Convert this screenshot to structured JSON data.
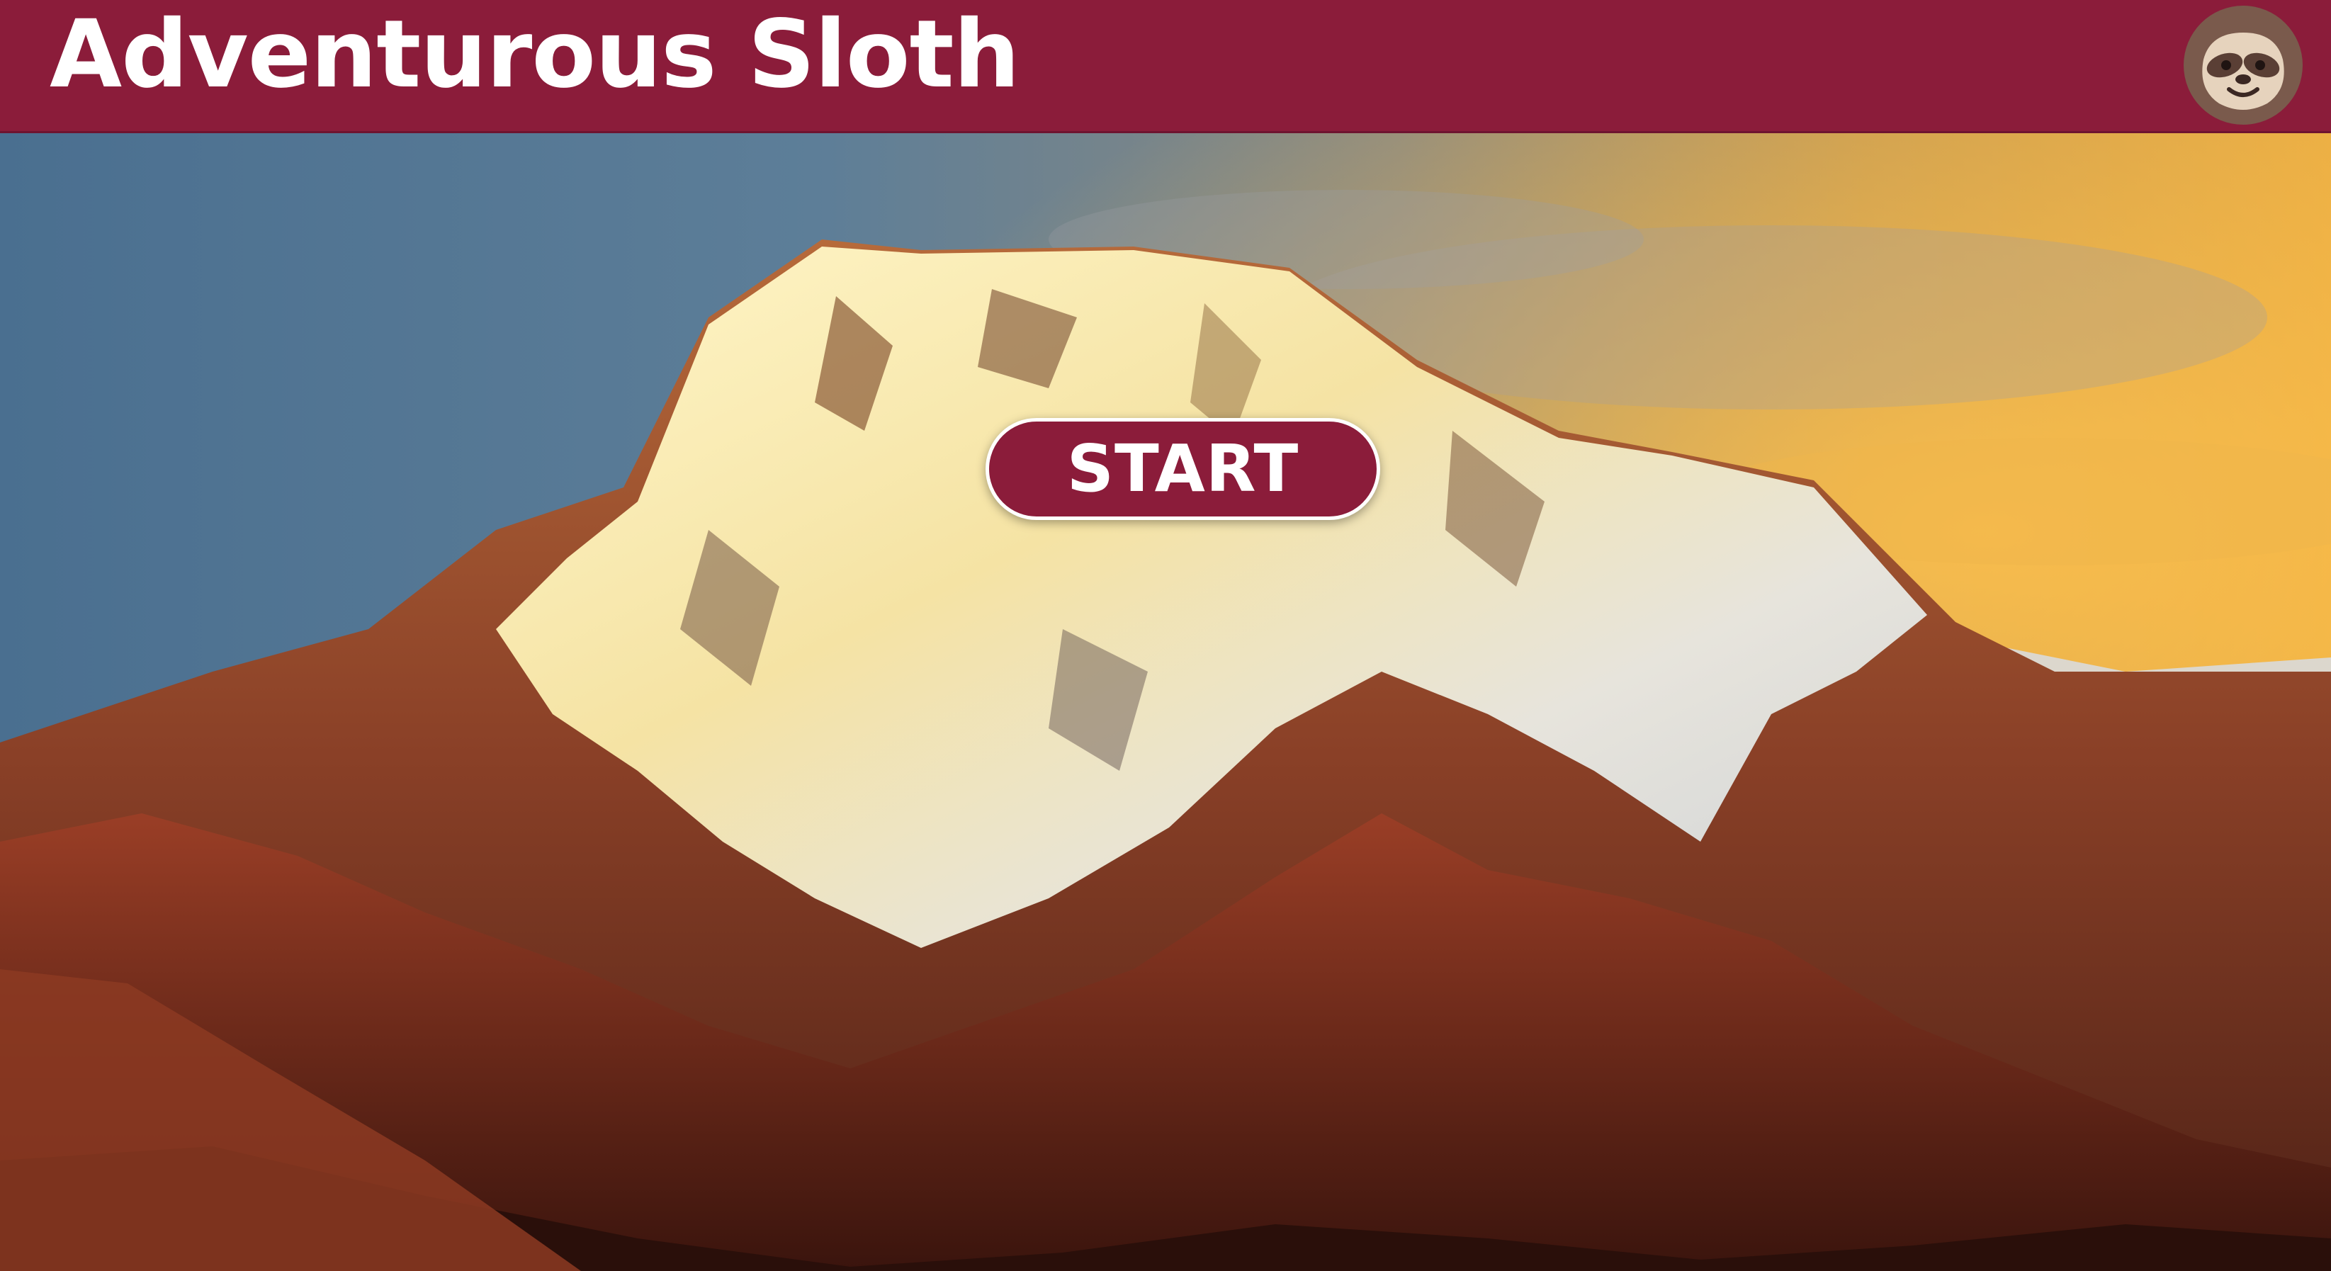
{
  "header": {
    "title": "Adventurous Sloth",
    "avatar_icon": "sloth-face-icon",
    "background_color": "#8b1c3a"
  },
  "main": {
    "background_image": "snowy-mountain-peak-at-sunset",
    "start_button": {
      "label": "START",
      "color": "#8b1c3a"
    }
  }
}
